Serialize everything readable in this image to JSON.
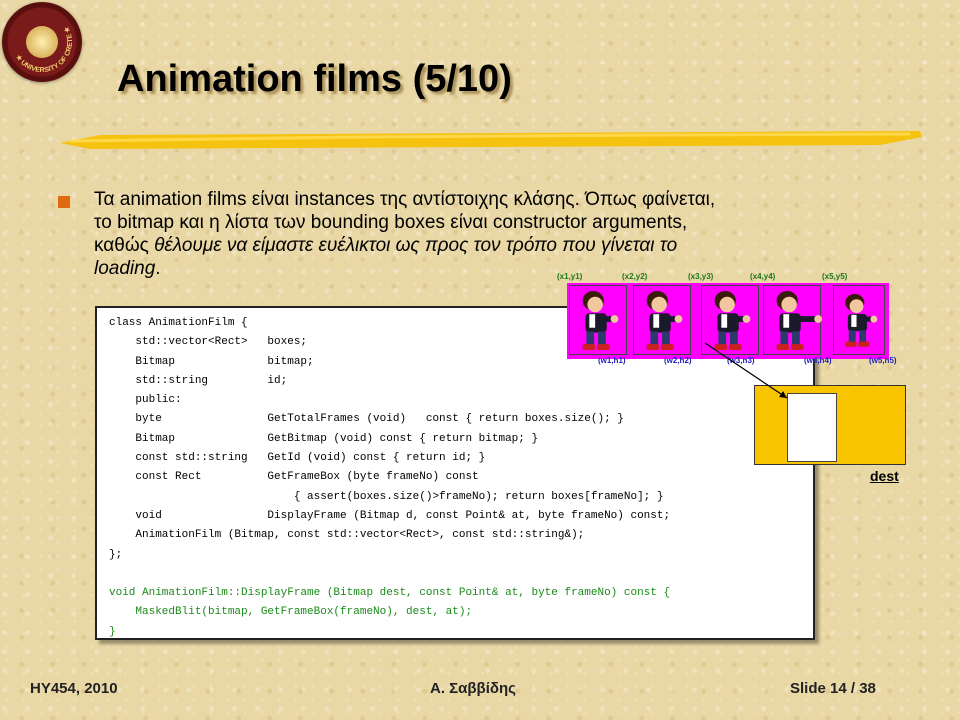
{
  "logo": {
    "text": "UNIVERSITY OF CRETE",
    "icon": "university-seal-icon"
  },
  "slide": {
    "title": "Animation films (5/10)"
  },
  "bullet": {
    "line1": "Τα animation films είναι instances της αντίστοιχης κλάσης. Όπως φαίνεται,",
    "line2": "το bitmap και  η λίστα των bounding boxes είναι constructor arguments,",
    "line3_normal": "καθώς ",
    "line3_italic": "θέλουμε να είμαστε ευέλικτοι ως προς τον τρόπο που γίνεται το",
    "line4_italic": "loading",
    "line4_end": "."
  },
  "code_lines": [
    {
      "text": "class AnimationFilm {",
      "color": "black"
    },
    {
      "text": "    std::vector<Rect>   boxes;",
      "color": "black"
    },
    {
      "text": "    Bitmap              bitmap;",
      "color": "black"
    },
    {
      "text": "    std::string         id;",
      "color": "black"
    },
    {
      "text": "    public:",
      "color": "black"
    },
    {
      "text": "    byte                GetTotalFrames (void)   const { return boxes.size(); }",
      "color": "black"
    },
    {
      "text": "    Bitmap              GetBitmap (void) const { return bitmap; }",
      "color": "black"
    },
    {
      "text": "    const std::string   GetId (void) const { return id; }",
      "color": "black"
    },
    {
      "text": "    const Rect          GetFrameBox (byte frameNo) const",
      "color": "black"
    },
    {
      "text": "                            { assert(boxes.size()>frameNo); return boxes[frameNo]; }",
      "color": "black"
    },
    {
      "text": "    void                DisplayFrame (Bitmap d, const Point& at, byte frameNo) const;",
      "color": "black"
    },
    {
      "text": "    AnimationFilm (Bitmap, const std::vector<Rect>, const std::string&);",
      "color": "black"
    },
    {
      "text": "};",
      "color": "black"
    },
    {
      "text": "",
      "color": "black"
    },
    {
      "text": "void AnimationFilm::DisplayFrame (Bitmap dest, const Point& at, byte frameNo) const {",
      "color": "green"
    },
    {
      "text": "    MaskedBlit(bitmap, GetFrameBox(frameNo), dest, at);",
      "color": "green"
    },
    {
      "text": "}",
      "color": "green"
    }
  ],
  "sprites": {
    "top_labels": [
      "(x1,y1)",
      "(x2,y2)",
      "(x3,y3)",
      "(x4,y4)",
      "(x5,y5)"
    ],
    "bottom_labels": [
      "(w1,h1)",
      "(w2,h2)",
      "(w3,h3)",
      "(w4,h4)",
      "(w5,h5)"
    ],
    "background_color": "#ff00ff"
  },
  "dest": {
    "label": "dest",
    "color": "#f8c400"
  },
  "footer": {
    "course": "HY454, 2010",
    "author": "Α. Σαββίδης",
    "slide": "Slide 14 / 38"
  }
}
